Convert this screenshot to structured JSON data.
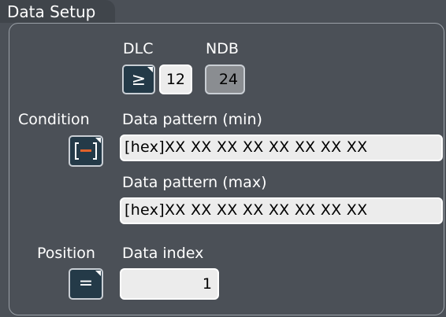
{
  "dialog": {
    "title": "Data Setup"
  },
  "dlc": {
    "label": "DLC",
    "operator_symbol": "≥",
    "value": "12"
  },
  "ndb": {
    "label": "NDB",
    "value": "24"
  },
  "condition": {
    "label": "Condition",
    "icon": "in-range-icon"
  },
  "pattern_min": {
    "label": "Data pattern (min)",
    "value": "[hex]XX XX XX XX XX XX XX XX"
  },
  "pattern_max": {
    "label": "Data pattern (max)",
    "value": "[hex]XX XX XX XX XX XX XX XX"
  },
  "position": {
    "label": "Position",
    "operator_symbol": "="
  },
  "data_index": {
    "label": "Data index",
    "value": "1"
  },
  "colors": {
    "background": "#4b5057",
    "button": "#243a48",
    "field": "#ececec",
    "accent": "#e0622a"
  }
}
